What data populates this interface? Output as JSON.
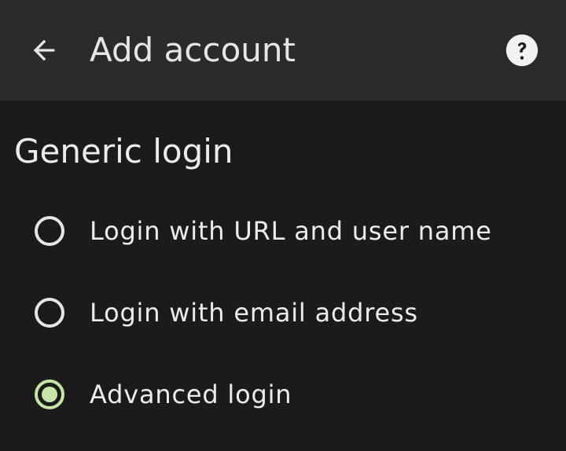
{
  "toolbar": {
    "back_icon": "arrow-back-icon",
    "title": "Add account",
    "help_icon": "help-circle-icon"
  },
  "section": {
    "title": "Generic login"
  },
  "options": [
    {
      "label": "Login with URL and user name",
      "selected": false
    },
    {
      "label": "Login with email address",
      "selected": false
    },
    {
      "label": "Advanced login",
      "selected": true
    }
  ],
  "colors": {
    "background": "#1b1b1b",
    "toolbar": "#2b2b2b",
    "accent": "#c5e6a6",
    "text": "#ececec"
  }
}
